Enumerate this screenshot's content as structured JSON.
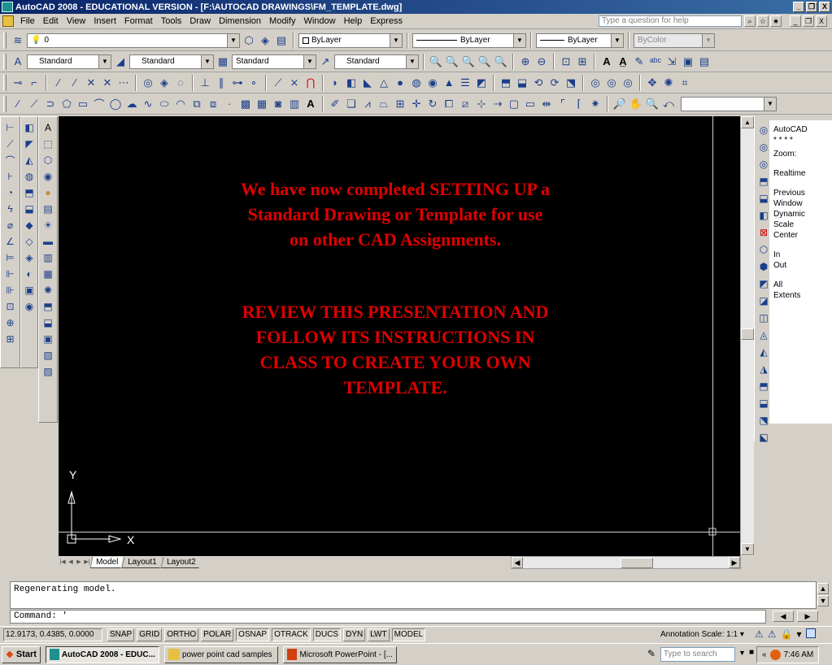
{
  "window": {
    "title": "AutoCAD 2008 - EDUCATIONAL VERSION - [F:\\AUTOCAD DRAWINGS\\FM_TEMPLATE.dwg]",
    "min_label": "_",
    "restore_label": "❐",
    "close_label": "X"
  },
  "menu": {
    "items": [
      "File",
      "Edit",
      "View",
      "Insert",
      "Format",
      "Tools",
      "Draw",
      "Dimension",
      "Modify",
      "Window",
      "Help",
      "Express"
    ],
    "help_placeholder": "Type a question for help"
  },
  "layers_toolbar": {
    "layer_value": "0",
    "color_value": "ByLayer",
    "linetype_value": "ByLayer",
    "lineweight_value": "ByLayer",
    "plotstyle_value": "ByColor"
  },
  "styles_toolbar": {
    "text_style": "Standard",
    "dim_style": "Standard",
    "table_style": "Standard",
    "mleader_style": "Standard"
  },
  "drawing": {
    "message_lines_1": [
      "We have now completed SETTING UP a",
      "Standard Drawing  or Template for use",
      "on other CAD Assignments."
    ],
    "message_lines_2": [
      "REVIEW THIS PRESENTATION AND",
      "FOLLOW ITS INSTRUCTIONS IN",
      "CLASS TO CREATE YOUR OWN",
      "TEMPLATE."
    ],
    "ucs_y_label": "Y",
    "ucs_x_label": "X",
    "background_color": "#000000",
    "text_color": "#e00000"
  },
  "layout_tabs": [
    "Model",
    "Layout1",
    "Layout2"
  ],
  "zoom_panel": {
    "lines": [
      "AutoCAD",
      "* * * *",
      "Zoom:",
      "",
      "Realtime",
      "",
      "Previous",
      "Window",
      "Dynamic",
      "Scale",
      "Center",
      "",
      "In",
      "Out",
      "",
      "All",
      "Extents"
    ]
  },
  "command": {
    "history": "Regenerating model.",
    "prompt": "Command: '"
  },
  "status": {
    "coords": "12.9173, 0.4385, 0.0000",
    "buttons": [
      "SNAP",
      "GRID",
      "ORTHO",
      "POLAR",
      "OSNAP",
      "OTRACK",
      "DUCS",
      "DYN",
      "LWT",
      "MODEL"
    ],
    "annotation_scale": "Annotation Scale:  1:1 ▾"
  },
  "taskbar": {
    "start_label": "Start",
    "tasks": [
      "AutoCAD 2008 - EDUC...",
      "power point cad samples",
      "Microsoft PowerPoint - [..."
    ],
    "search_placeholder": "Type to search",
    "clock": "7:46 AM"
  }
}
